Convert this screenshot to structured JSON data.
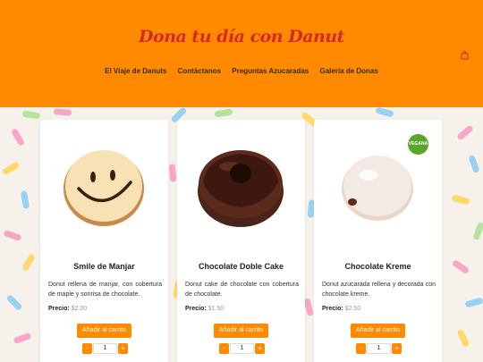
{
  "site": {
    "brand": "Dona tu día con Danut"
  },
  "nav": [
    "El Viaje de Danuts",
    "Contáctanos",
    "Preguntas Azucaradas",
    "Galeria de Donas"
  ],
  "colors": {
    "header": "#ff8a00",
    "brand": "#d62a2a",
    "button": "#ff8a00"
  },
  "products": [
    {
      "name": "Smile de Manjar",
      "description": "Donut rellena de manjar, con cobertura de maple y sonrisa de chocolate.",
      "price_label": "Precio:",
      "price": "$2.00",
      "button": "Añadir al carrito",
      "qty": "1",
      "badge": ""
    },
    {
      "name": "Chocolate Doble Cake",
      "description": "Donut cake de chocolate con cobertura de chocolate.",
      "price_label": "Precio:",
      "price": "$1.50",
      "button": "Añadir al carrito",
      "qty": "1",
      "badge": ""
    },
    {
      "name": "Chocolate Kreme",
      "description": "Donut azucarada rellena y decorada con chocolate kreme.",
      "price_label": "Precio:",
      "price": "$2.50",
      "button": "Añadir al carrito",
      "qty": "1",
      "badge": "VEGANA"
    }
  ],
  "qty_controls": {
    "minus": "-",
    "plus": "+"
  }
}
